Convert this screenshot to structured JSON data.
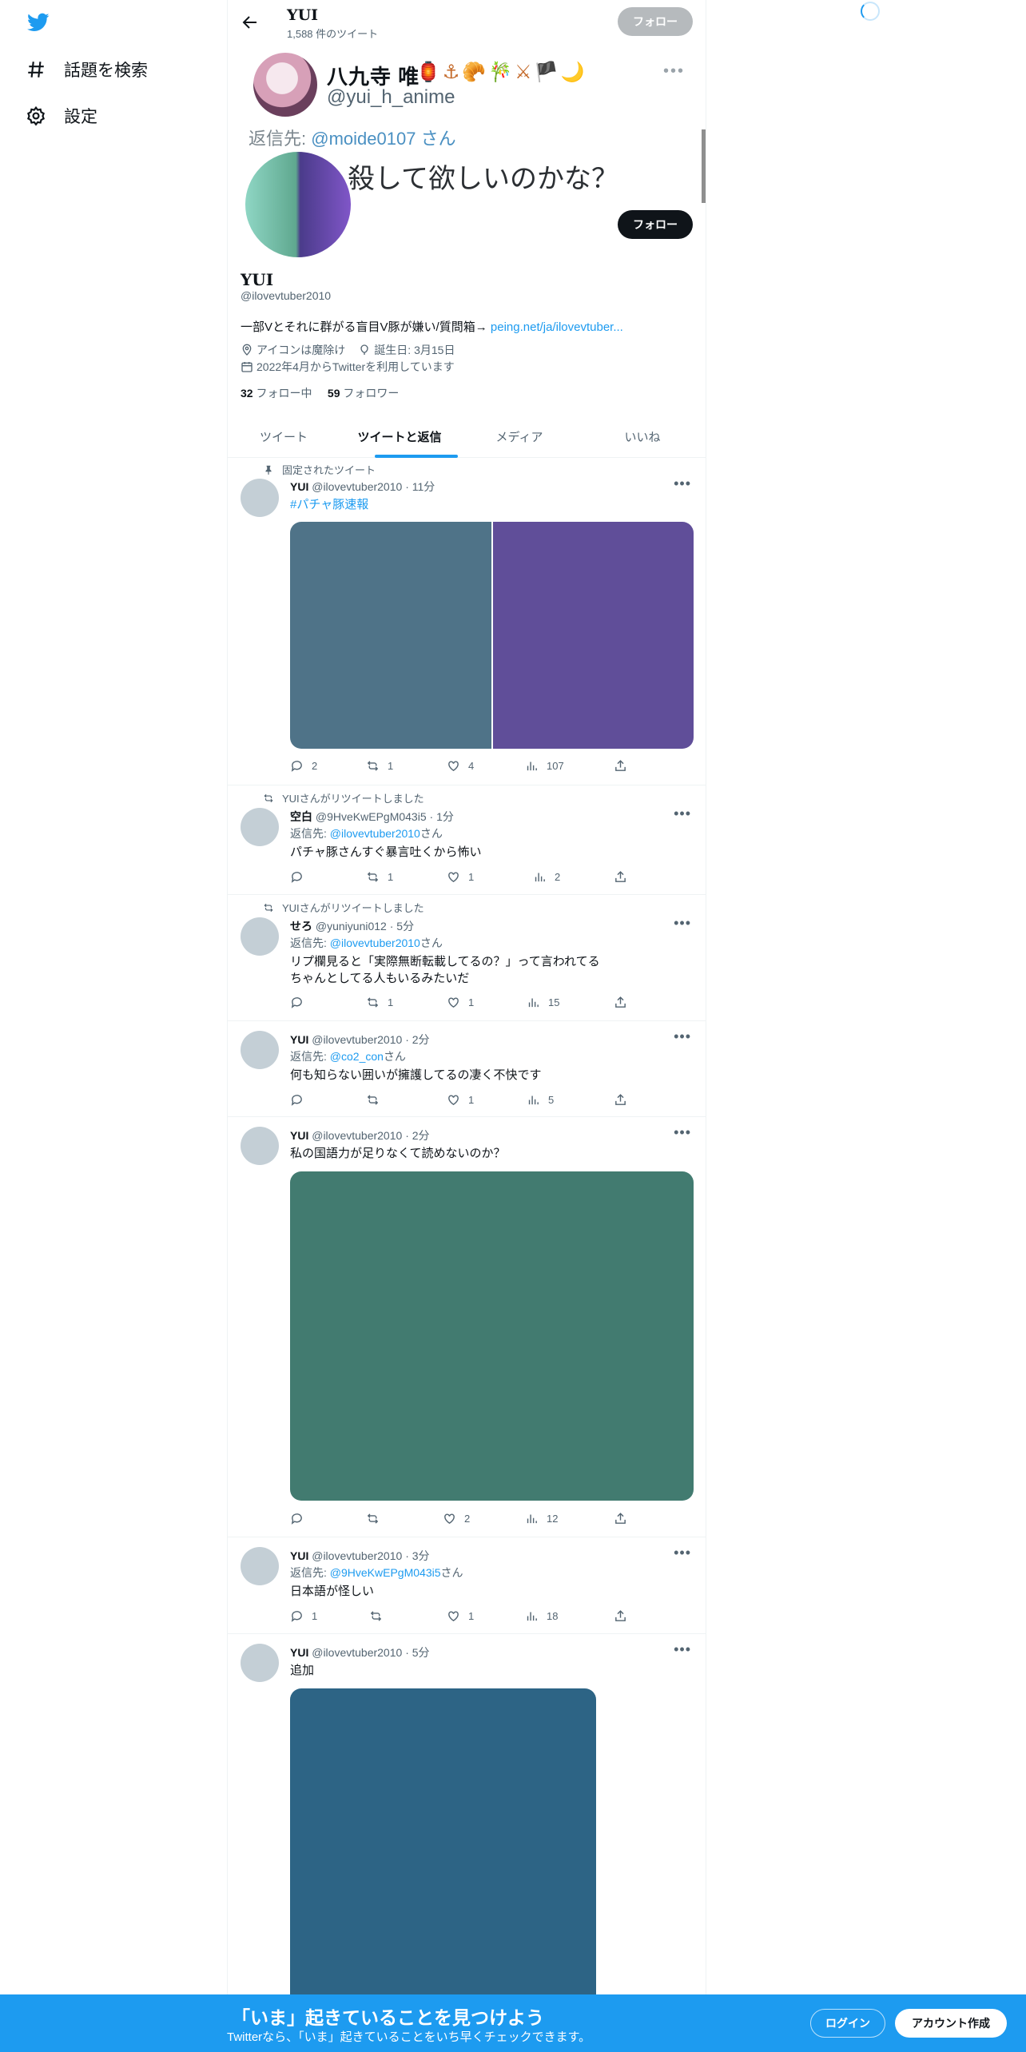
{
  "nav": {
    "explore": "話題を検索",
    "settings": "設定"
  },
  "header": {
    "name": "YUI",
    "tweet_count": "1,588 件のツイート",
    "follow": "フォロー"
  },
  "banner": {
    "name": "八九寺 唯",
    "emoji": "🏮⚓🥐🎋⚔🏴🌙",
    "handle": "@yui_h_anime",
    "dots": "•••",
    "reply_prefix": "返信先:",
    "reply_mention": "@moide0107",
    "reply_suffix": "さん",
    "quote": "殺して欲しいのかな？"
  },
  "profile": {
    "name": "YUI",
    "handle": "@ilovevtuber2010",
    "follow_button": "フォロー",
    "bio": "一部Vとそれに群がる盲目V豚が嫌い/質問箱→ ",
    "bio_link": "peing.net/ja/ilovevtuber...",
    "location": "アイコンは魔除け",
    "birthday": "誕生日: 3月15日",
    "joined": "2022年4月からTwitterを利用しています",
    "following_count": "32",
    "following_label": "フォロー中",
    "followers_count": "59",
    "followers_label": "フォロワー"
  },
  "tabs": [
    "ツイート",
    "ツイートと返信",
    "メディア",
    "いいね"
  ],
  "more": "•••",
  "tweets": [
    {
      "context": "固定されたツイート",
      "name": "YUI",
      "handle": "@ilovevtuber2010",
      "sep": "·",
      "time": "11分",
      "text": "#パチャ豚速報",
      "media_colors": [
        "#4f7388",
        "#604e99"
      ],
      "reply": "2",
      "retweet": "1",
      "like": "4",
      "views": "107"
    },
    {
      "context": "YUIさんがリツイートしました",
      "name": "空白",
      "handle": "@9HveKwEPgM043i5",
      "sep": "·",
      "time": "1分",
      "reply_prefix": "返信先: ",
      "reply_to": "@ilovevtuber2010",
      "reply_suffix": "さん",
      "text": "パチャ豚さんすぐ暴言吐くから怖い",
      "reply": "",
      "retweet": "1",
      "like": "1",
      "views": "2"
    },
    {
      "context": "YUIさんがリツイートしました",
      "name": "せろ",
      "handle": "@yuniyuni012",
      "sep": "·",
      "time": "5分",
      "reply_prefix": "返信先: ",
      "reply_to": "@ilovevtuber2010",
      "reply_suffix": "さん",
      "text": "リプ欄見ると「実際無断転載してるの？」って言われてる",
      "text2": "ちゃんとしてる人もいるみたいだ",
      "reply": "",
      "retweet": "1",
      "like": "1",
      "views": "15"
    },
    {
      "name": "YUI",
      "handle": "@ilovevtuber2010",
      "sep": "·",
      "time": "2分",
      "reply_prefix": "返信先: ",
      "reply_to": "@co2_con",
      "reply_suffix": "さん",
      "text": "何も知らない囲いが擁護してるの凄く不快です",
      "reply": "",
      "retweet": "",
      "like": "1",
      "views": "5"
    },
    {
      "name": "YUI",
      "handle": "@ilovevtuber2010",
      "sep": "·",
      "time": "2分",
      "text": "私の国語力が足りなくて読めないのか？",
      "media_colors": [
        "#427b70"
      ],
      "reply": "",
      "retweet": "",
      "like": "2",
      "views": "12"
    },
    {
      "name": "YUI",
      "handle": "@ilovevtuber2010",
      "sep": "·",
      "time": "3分",
      "reply_prefix": "返信先: ",
      "reply_to": "@9HveKwEPgM043i5",
      "reply_suffix": "さん",
      "text": "日本語が怪しい",
      "reply": "1",
      "retweet": "",
      "like": "1",
      "views": "18"
    },
    {
      "name": "YUI",
      "handle": "@ilovevtuber2010",
      "sep": "·",
      "time": "5分",
      "text": "追加",
      "media_colors": [
        "#2d6485"
      ]
    }
  ],
  "bottom": {
    "title": "「いま」起きていることを見つけよう",
    "subtitle": "Twitterなら、「いま」起きていることをいち早くチェックできます。",
    "login": "ログイン",
    "signup": "アカウント作成"
  },
  "colors": {
    "accent": "#1d9bf0",
    "text": "#0f1419",
    "secondary": "#536471"
  }
}
